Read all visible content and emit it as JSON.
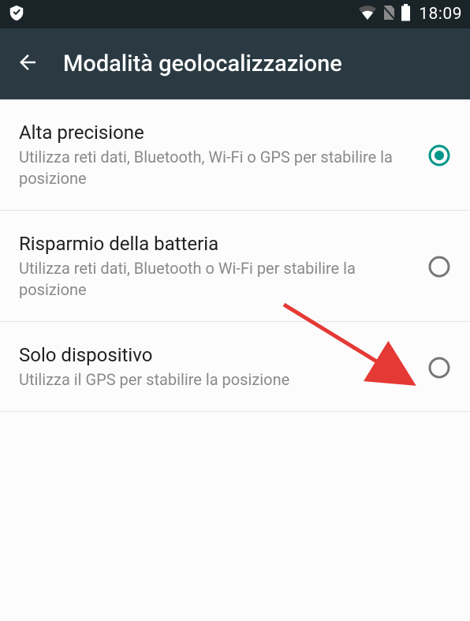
{
  "status_bar": {
    "time": "18:09"
  },
  "header": {
    "title": "Modalità geolocalizzazione"
  },
  "options": [
    {
      "title": "Alta precisione",
      "description": "Utilizza reti dati, Bluetooth, Wi-Fi o GPS per stabilire la posizione",
      "selected": true
    },
    {
      "title": "Risparmio della batteria",
      "description": "Utilizza reti dati, Bluetooth o Wi-Fi per stabilire la posizione",
      "selected": false
    },
    {
      "title": "Solo dispositivo",
      "description": "Utilizza il GPS per stabilire la posizione",
      "selected": false
    }
  ]
}
